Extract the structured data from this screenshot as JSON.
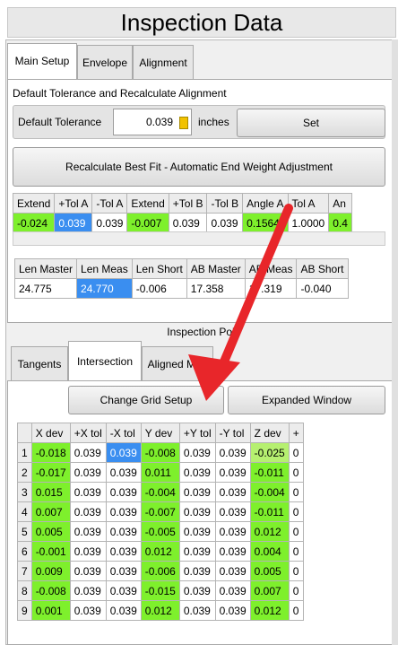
{
  "title": "Inspection Data",
  "tabs": [
    "Main Setup",
    "Envelope",
    "Alignment"
  ],
  "section1_label": "Default Tolerance and Recalculate Alignment",
  "default_tolerance": {
    "label": "Default Tolerance",
    "value": "0.039",
    "unit": "inches",
    "set_label": "Set"
  },
  "recalc_label": "Recalculate Best Fit - Automatic End Weight Adjustment",
  "table1": {
    "headers": [
      "Extend",
      "+Tol A",
      "-Tol A",
      "Extend",
      "+Tol B",
      "-Tol B",
      "Angle A",
      "Tol A",
      "An"
    ],
    "row": [
      "-0.024",
      "0.039",
      "0.039",
      "-0.007",
      "0.039",
      "0.039",
      "0.1564",
      "1.0000",
      "0.4"
    ]
  },
  "table2": {
    "headers": [
      "Len Master",
      "Len Meas",
      "Len Short",
      "AB Master",
      "AB Meas",
      "AB Short"
    ],
    "row": [
      "24.775",
      "24.770",
      "-0.006",
      "17.358",
      "17.319",
      "-0.040"
    ]
  },
  "inspection_points_label": "Inspection Poi",
  "sub_tabs": [
    "Tangents",
    "Intersection",
    "Aligned Mod"
  ],
  "change_grid_label": "Change Grid Setup",
  "expanded_window_label": "Expanded Window",
  "grid": {
    "headers": [
      "",
      "X dev",
      "+X tol",
      "-X tol",
      "Y dev",
      "+Y tol",
      "-Y tol",
      "Z dev",
      "+"
    ],
    "rows": [
      [
        "1",
        "-0.018",
        "0.039",
        "0.039",
        "-0.008",
        "0.039",
        "0.039",
        "-0.025",
        "0"
      ],
      [
        "2",
        "-0.017",
        "0.039",
        "0.039",
        "0.011",
        "0.039",
        "0.039",
        "-0.011",
        "0"
      ],
      [
        "3",
        "0.015",
        "0.039",
        "0.039",
        "-0.004",
        "0.039",
        "0.039",
        "-0.004",
        "0"
      ],
      [
        "4",
        "0.007",
        "0.039",
        "0.039",
        "-0.007",
        "0.039",
        "0.039",
        "-0.011",
        "0"
      ],
      [
        "5",
        "0.005",
        "0.039",
        "0.039",
        "-0.005",
        "0.039",
        "0.039",
        "0.012",
        "0"
      ],
      [
        "6",
        "-0.001",
        "0.039",
        "0.039",
        "0.012",
        "0.039",
        "0.039",
        "0.004",
        "0"
      ],
      [
        "7",
        "0.009",
        "0.039",
        "0.039",
        "-0.006",
        "0.039",
        "0.039",
        "0.005",
        "0"
      ],
      [
        "8",
        "-0.008",
        "0.039",
        "0.039",
        "-0.015",
        "0.039",
        "0.039",
        "0.007",
        "0"
      ],
      [
        "9",
        "0.001",
        "0.039",
        "0.039",
        "0.012",
        "0.039",
        "0.039",
        "0.012",
        "0"
      ]
    ]
  },
  "colors": {
    "accent_green": "#7ef02c",
    "selected_blue": "#3a8ef0",
    "arrow_red": "#e8262a"
  }
}
